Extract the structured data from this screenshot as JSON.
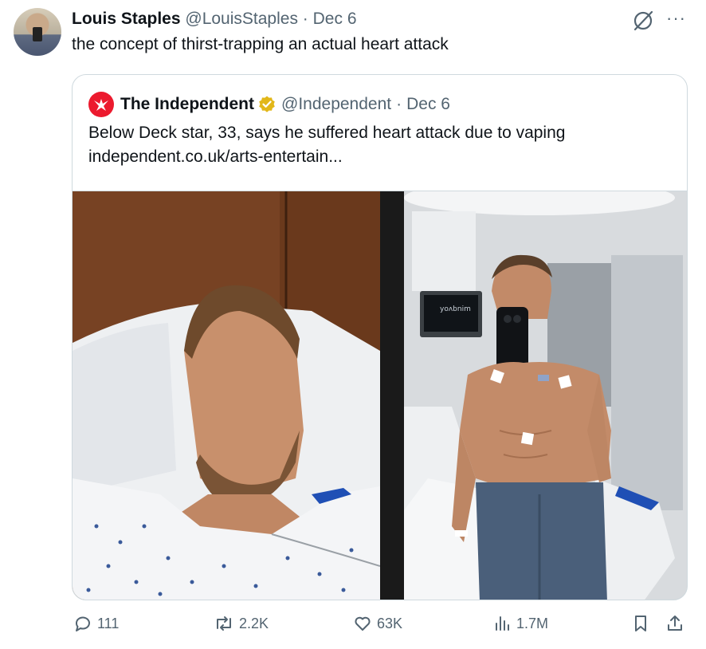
{
  "tweet": {
    "author_name": "Louis Staples",
    "author_handle": "@LouisStaples",
    "separator": "·",
    "date": "Dec 6",
    "text": "the concept of thirst-trapping an actual heart attack",
    "more_label": "···"
  },
  "quote": {
    "author_name": "The Independent",
    "author_handle": "@Independent",
    "separator": "·",
    "date": "Dec 6",
    "text": "Below Deck star, 33, says he suffered heart attack due to vaping",
    "link": "independent.co.uk/arts-entertain...",
    "monitor_text": "yoʌbnim"
  },
  "actions": {
    "replies": "111",
    "reposts": "2.2K",
    "likes": "63K",
    "views": "1.7M"
  },
  "colors": {
    "text": "#0f1419",
    "muted": "#536471",
    "border": "#cfd9de",
    "independent_red": "#ec1a2e",
    "verified_gold": "#e2b719"
  },
  "icons": [
    "grok-icon",
    "more-icon",
    "independent-logo",
    "verified-badge-icon",
    "reply-icon",
    "repost-icon",
    "like-icon",
    "views-icon",
    "bookmark-icon",
    "share-icon"
  ]
}
